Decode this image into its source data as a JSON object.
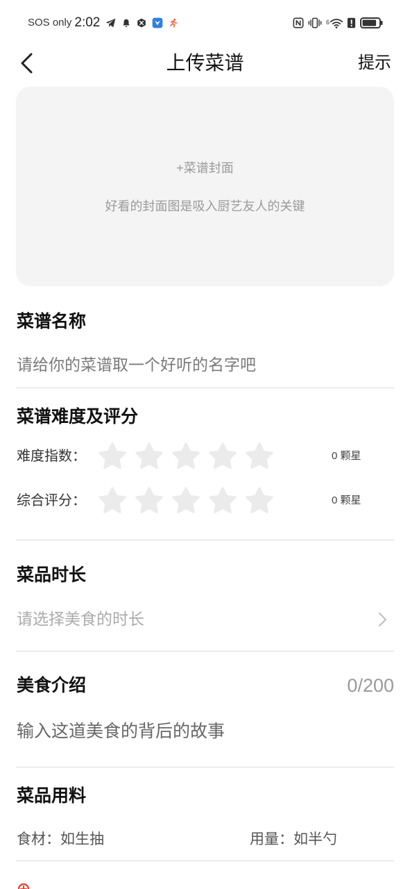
{
  "status_bar": {
    "carrier": "SOS only",
    "time": "2:02",
    "left_icons": [
      "telegram-icon",
      "bell-icon",
      "security-icon",
      "blue-app-icon",
      "running-icon"
    ],
    "right_icons": [
      "nfc-icon",
      "vibrate-icon",
      "wifi-icon",
      "sim-alert-icon",
      "battery-icon"
    ],
    "wifi_badge": "6",
    "battery_level": 0.85
  },
  "header": {
    "back_icon": "chevron-left-icon",
    "title": "上传菜谱",
    "hint_label": "提示"
  },
  "cover": {
    "add_label": "+菜谱封面",
    "tip": "好看的封面图是吸入厨艺友人的关键"
  },
  "recipe_name": {
    "heading": "菜谱名称",
    "placeholder": "请给你的菜谱取一个好听的名字吧"
  },
  "rating": {
    "heading": "菜谱难度及评分",
    "rows": [
      {
        "label": "难度指数：",
        "stars": 0,
        "max_stars": 5,
        "value_text": "0 颗星"
      },
      {
        "label": "综合评分：",
        "stars": 0,
        "max_stars": 5,
        "value_text": "0 颗星"
      }
    ]
  },
  "duration": {
    "heading": "菜品时长",
    "placeholder": "请选择美食的时长",
    "chevron_icon": "chevron-right-icon"
  },
  "intro": {
    "heading": "美食介绍",
    "counter": "0/200",
    "placeholder": "输入这道美食的背后的故事"
  },
  "ingredients": {
    "heading": "菜品用料",
    "rows": [
      {
        "ingredient_placeholder": "食材：如生抽",
        "amount_placeholder": "用量：如半勺"
      }
    ]
  },
  "colors": {
    "background": "#ffffff",
    "cover_bg": "#f4f4f4",
    "star_empty": "#ebebeb",
    "divider": "#dcdcdc",
    "accent_red": "#e0433a"
  }
}
